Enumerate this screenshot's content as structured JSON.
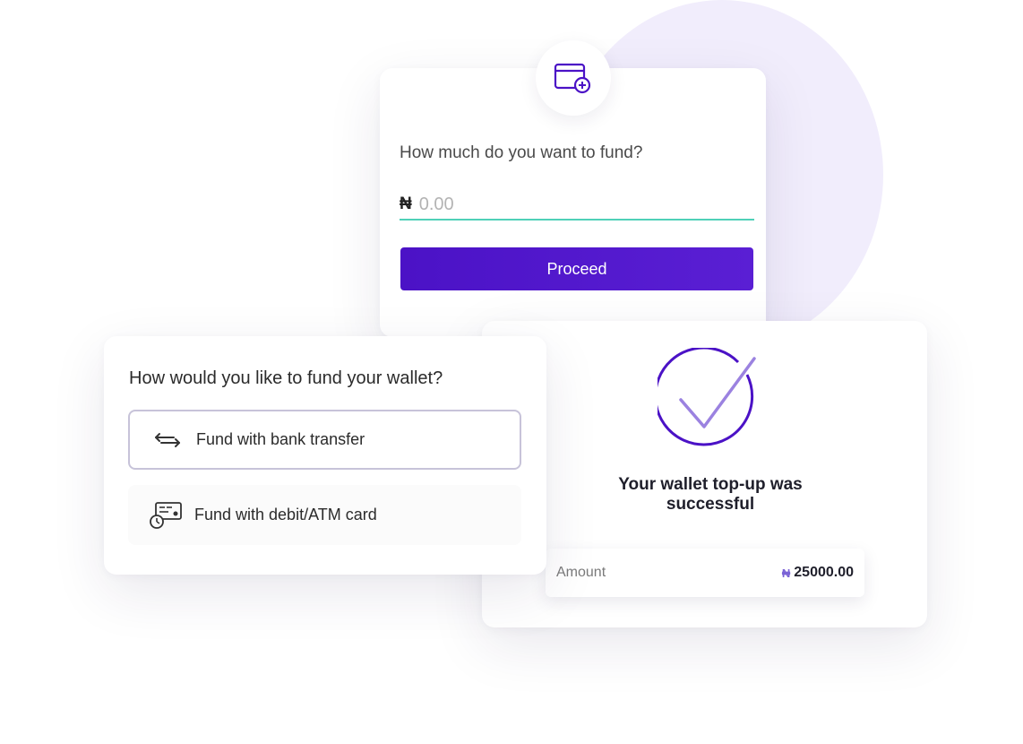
{
  "colors": {
    "accent": "#4b12c6",
    "input_underline": "#4fd1b8",
    "background_circle": "#f1edfc",
    "check_stroke": "#4b12c6",
    "check_mark": "#9b82e0"
  },
  "fund_card": {
    "icon": "wallet-add-icon",
    "question": "How much do you want to fund?",
    "currency_symbol": "₦",
    "amount_placeholder": "0.00",
    "proceed_label": "Proceed"
  },
  "method_card": {
    "question": "How would you like to fund your wallet?",
    "options": [
      {
        "label": "Fund with bank transfer",
        "icon": "transfer-arrows-icon",
        "selected": true
      },
      {
        "label": "Fund with debit/ATM card",
        "icon": "card-icon",
        "selected": false
      }
    ]
  },
  "success_card": {
    "icon": "check-circle-icon",
    "message": "Your wallet top-up was successful",
    "amount_label": "Amount",
    "currency_symbol": "₦",
    "amount_value": "25000.00"
  }
}
